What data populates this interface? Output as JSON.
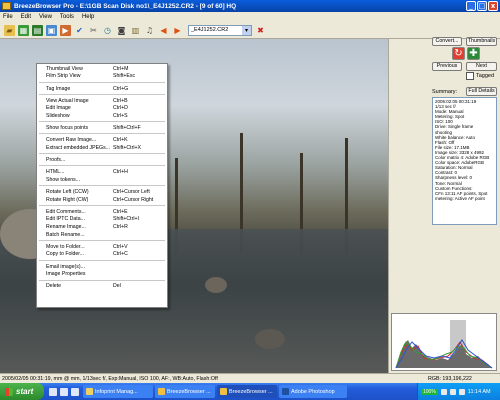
{
  "window": {
    "title": "BreezeBrowser Pro - E:\\1GB Scan Disk no1\\_E4J1252.CR2 - [9 of 60] HQ",
    "controls": [
      "_",
      "□",
      "x"
    ]
  },
  "menubar": [
    "File",
    "Edit",
    "View",
    "Tools",
    "Help"
  ],
  "toolbar": {
    "combo_value": "_E4J1252.CR2",
    "icons": [
      "open-folder-icon",
      "grid-view-icon",
      "filmstrip-icon",
      "single-view-icon",
      "slideshow-icon",
      "tag-check-icon",
      "tools-icon",
      "clock-icon",
      "camera-icon",
      "convert-icon",
      "music-icon",
      "back-arrow-icon",
      "forward-arrow-icon",
      "delete-x-icon"
    ]
  },
  "context_menu": {
    "groups": [
      [
        {
          "label": "Thumbnail View",
          "shortcut": "Ctrl+M"
        },
        {
          "label": "Film Strip View",
          "shortcut": "Shift+Esc"
        }
      ],
      [
        {
          "label": "Tag Image",
          "shortcut": "Ctrl+G"
        }
      ],
      [
        {
          "label": "View Actual Image",
          "shortcut": "Ctrl+B"
        },
        {
          "label": "Edit Image",
          "shortcut": "Ctrl+D"
        },
        {
          "label": "Slideshow",
          "shortcut": "Ctrl+S"
        }
      ],
      [
        {
          "label": "Show focus points",
          "shortcut": "Shift+Ctrl+F"
        }
      ],
      [
        {
          "label": "Convert Raw Image...",
          "shortcut": "Ctrl+K"
        },
        {
          "label": "Extract embedded JPEGs...",
          "shortcut": "Shift+Ctrl+X"
        }
      ],
      [
        {
          "label": "Proofs...",
          "shortcut": ""
        }
      ],
      [
        {
          "label": "HTML...",
          "shortcut": "Ctrl+H"
        },
        {
          "label": "Show tokens...",
          "shortcut": ""
        }
      ],
      [
        {
          "label": "Rotate Left (CCW)",
          "shortcut": "Ctrl+Cursor Left"
        },
        {
          "label": "Rotate Right (CW)",
          "shortcut": "Ctrl+Cursor Right"
        }
      ],
      [
        {
          "label": "Edit Comments...",
          "shortcut": "Ctrl+E"
        },
        {
          "label": "Edit IPTC Data...",
          "shortcut": "Shift+Ctrl+I"
        },
        {
          "label": "Rename Image...",
          "shortcut": "Ctrl+R"
        },
        {
          "label": "Batch Rename...",
          "shortcut": ""
        }
      ],
      [
        {
          "label": "Move to Folder...",
          "shortcut": "Ctrl+V"
        },
        {
          "label": "Copy to Folder...",
          "shortcut": "Ctrl+C"
        }
      ],
      [
        {
          "label": "Email image(s)...",
          "shortcut": ""
        },
        {
          "label": "Image Properties",
          "shortcut": ""
        }
      ],
      [
        {
          "label": "Delete",
          "shortcut": "Del"
        }
      ]
    ]
  },
  "right_panel": {
    "convert_label": "Convert...",
    "thumbnails_label": "Thumbnails",
    "previous_label": "Previous",
    "next_label": "Next",
    "tagged_label": "Tagged",
    "summary_label": "Summary:",
    "full_details_label": "Full Details",
    "summary_lines": [
      "2005:02:05 00:31:19",
      "1/13 sec f/",
      "Mode: Manual",
      "Metering: Spot",
      "ISO: 100",
      "Drive: Single frame",
      "shooting",
      "White balance: Auto",
      "Flash: Off",
      "File size: 17.1MB",
      "Image size: 3328 x 4992",
      "Color matrix 4: Adobe RGB",
      "Color space: AdobeRGB",
      "Saturation: Normal",
      "Contrast: 0",
      "Sharpness level: 0",
      "Tone: Normal",
      "Custom Functions:",
      "CFn 13:11 AF points, Spot",
      "metering: Active AF point"
    ]
  },
  "status": {
    "left": "2005/02/05 00:31:19, mm @ mm, 1/13sec f/, Exp:Manual, ISO 100, AF:, WB:Auto, Flash:Off",
    "right": "RGB: 193,196,222"
  },
  "taskbar": {
    "start_label": "start",
    "tasks": [
      {
        "label": "Infoprint Manag...",
        "active": false
      },
      {
        "label": "BreezeBrowser ...",
        "active": false
      },
      {
        "label": "BreezeBrowser ...",
        "active": true
      },
      {
        "label": "Adobe Photoshop",
        "active": false
      }
    ],
    "battery": "100%",
    "clock": "11:14 AM"
  }
}
